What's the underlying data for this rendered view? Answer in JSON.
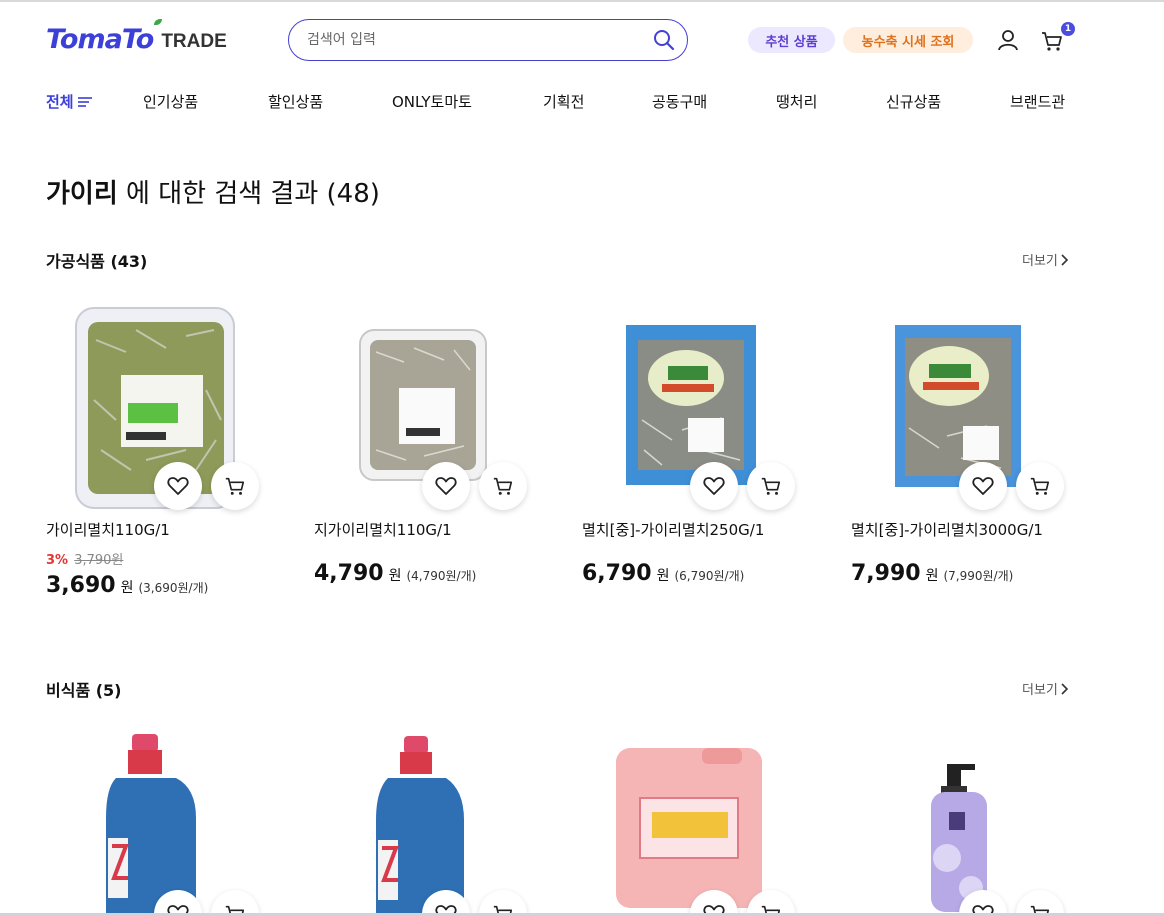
{
  "header": {
    "logo_main": "TomaTo",
    "logo_sub": "TRADE",
    "search_placeholder": "검색어 입력",
    "recommend_label": "추천 상품",
    "price_label": "농수축 시세 조회",
    "cart_count": "1"
  },
  "nav": {
    "all_label": "전체",
    "items": [
      "인기상품",
      "할인상품",
      "ONLY토마토",
      "기획전",
      "공동구매",
      "땡처리",
      "신규상품",
      "브랜드관"
    ]
  },
  "results": {
    "keyword": "가이리",
    "suffix": "에 대한 검색 결과 (48)"
  },
  "sections": [
    {
      "title": "가공식품 (43)",
      "more_label": "더보기",
      "products": [
        {
          "name": "가이리멸치110G/1",
          "discount_pct": "3%",
          "original_price": "3,790원",
          "price": "3,690",
          "won": "원",
          "unit_price": "(3,690원/개)"
        },
        {
          "name": "지가이리멸치110G/1",
          "price": "4,790",
          "won": "원",
          "unit_price": "(4,790원/개)"
        },
        {
          "name": "멸치[중]-가이리멸치250G/1",
          "price": "6,790",
          "won": "원",
          "unit_price": "(6,790원/개)"
        },
        {
          "name": "멸치[중]-가이리멸치3000G/1",
          "price": "7,990",
          "won": "원",
          "unit_price": "(7,990원/개)"
        }
      ]
    },
    {
      "title": "비식품 (5)",
      "more_label": "더보기"
    }
  ],
  "colors": {
    "brand": "#3c3fd8",
    "discount": "#e43535"
  }
}
